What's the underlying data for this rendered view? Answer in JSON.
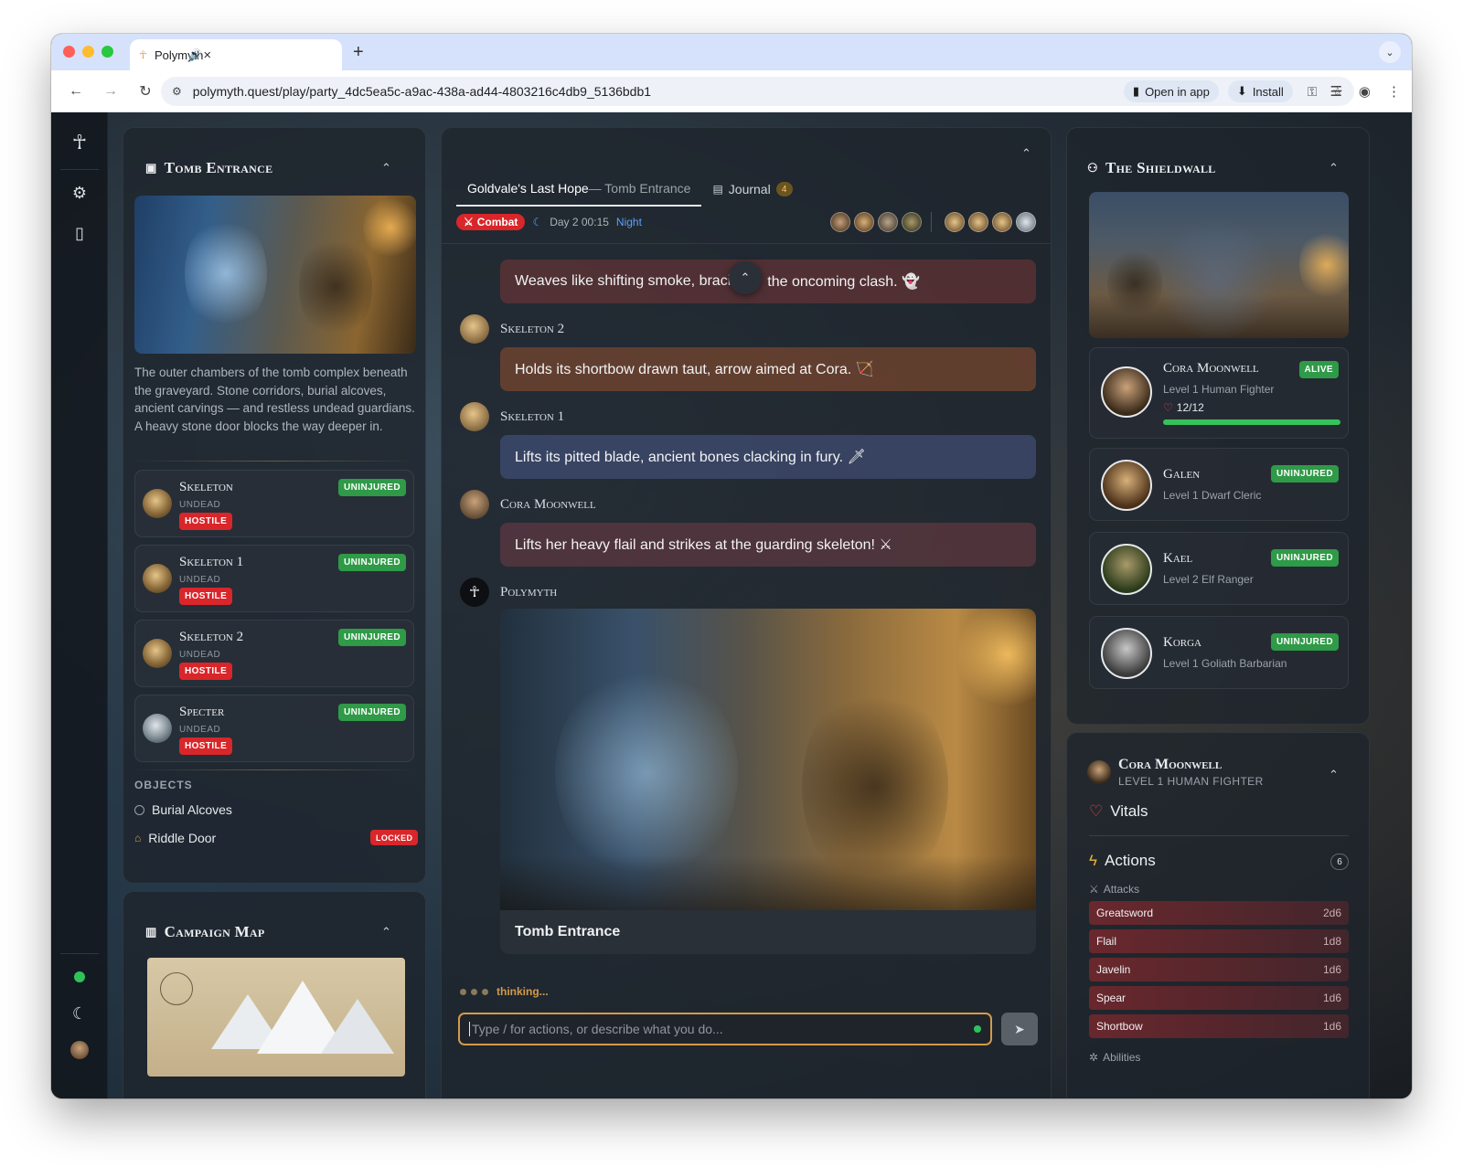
{
  "browser": {
    "tab_title": "Polymyth",
    "new_tab": "+",
    "url": "polymyth.quest/play/party_4dc5ea5c-a9ac-438a-ad44-4803216c4db9_5136bdb1",
    "open_in_app": "Open in app",
    "install": "Install"
  },
  "scene": {
    "title": "Tomb Entrance",
    "description": "The outer chambers of the tomb complex beneath the graveyard. Stone corridors, burial alcoves, ancient carvings — and restless undead guardians. A heavy stone door blocks the way deeper in.",
    "creatures": [
      {
        "name": "Skeleton",
        "type": "UNDEAD",
        "status": "UNINJURED",
        "disposition": "HOSTILE"
      },
      {
        "name": "Skeleton 1",
        "type": "UNDEAD",
        "status": "UNINJURED",
        "disposition": "HOSTILE"
      },
      {
        "name": "Skeleton 2",
        "type": "UNDEAD",
        "status": "UNINJURED",
        "disposition": "HOSTILE"
      },
      {
        "name": "Specter",
        "type": "UNDEAD",
        "status": "UNINJURED",
        "disposition": "HOSTILE"
      }
    ],
    "objects_label": "OBJECTS",
    "objects": [
      {
        "name": "Burial Alcoves",
        "badge": ""
      },
      {
        "name": "Riddle Door",
        "badge": "LOCKED"
      }
    ]
  },
  "campaign_map": {
    "title": "Campaign Map"
  },
  "chat": {
    "tab_story": "Goldvale's Last Hope",
    "tab_story_sub": "— Tomb Entrance",
    "tab_journal": "Journal",
    "journal_count": "4",
    "combat_label": "Combat",
    "time": "Day 2 00:15",
    "period": "Night",
    "messages": [
      {
        "speaker": "",
        "text": "Weaves like shifting smoke, braci",
        "text2": "the oncoming clash. 👻"
      },
      {
        "speaker": "Skeleton 2",
        "text": "Holds its shortbow drawn taut, arrow aimed at Cora. 🏹"
      },
      {
        "speaker": "Skeleton 1",
        "text": "Lifts its pitted blade, ancient bones clacking in fury. 🗡"
      },
      {
        "speaker": "Cora Moonwell",
        "text": "Lifts her heavy flail and strikes at the guarding skeleton! ⚔"
      }
    ],
    "narrator": "Polymyth",
    "image_caption": "Tomb Entrance",
    "thinking": "thinking...",
    "input_placeholder": "Type / for actions, or describe what you do..."
  },
  "party": {
    "title": "The Shieldwall",
    "members": [
      {
        "name": "Cora Moonwell",
        "level": "Level 1 Human Fighter",
        "status": "ALIVE",
        "hp": "12/12",
        "hp_fraction": 1.0
      },
      {
        "name": "Galen",
        "level": "Level 1 Dwarf Cleric",
        "status": "UNINJURED"
      },
      {
        "name": "Kael",
        "level": "Level 2 Elf Ranger",
        "status": "UNINJURED"
      },
      {
        "name": "Korga",
        "level": "Level 1 Goliath Barbarian",
        "status": "UNINJURED"
      }
    ]
  },
  "character": {
    "name": "Cora Moonwell",
    "subtitle": "LEVEL 1 HUMAN FIGHTER",
    "vitals": "Vitals",
    "actions": "Actions",
    "actions_count": "6",
    "attacks_label": "Attacks",
    "attacks": [
      {
        "name": "Greatsword",
        "dice": "2d6"
      },
      {
        "name": "Flail",
        "dice": "1d8"
      },
      {
        "name": "Javelin",
        "dice": "1d6"
      },
      {
        "name": "Spear",
        "dice": "1d6"
      },
      {
        "name": "Shortbow",
        "dice": "1d6"
      }
    ],
    "abilities_label": "Abilities"
  },
  "colors": {
    "accent": "#d39a4a",
    "green": "#2f9a47",
    "red": "#d9262a",
    "night": "#5aa0ff"
  }
}
